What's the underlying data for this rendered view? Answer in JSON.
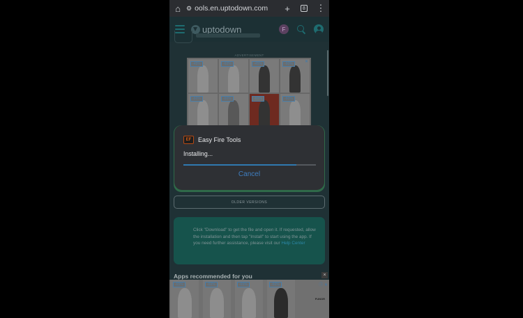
{
  "browser": {
    "url": "ools.en.uptodown.com",
    "tab_count": "8"
  },
  "site": {
    "logo_text": "uptodown",
    "ext_badge": "F"
  },
  "ad_top": {
    "label": "ADVERTISEMENT",
    "discounts": [
      "-45%",
      "-60%",
      "-45%",
      "-60%",
      "-60%",
      "-60%",
      "-60%",
      "-60%"
    ]
  },
  "dialog": {
    "app_name": "Easy Fire Tools",
    "status": "Installing...",
    "progress": 0.85,
    "cancel_label": "Cancel"
  },
  "older_versions_label": "OLDER VERSIONS",
  "info": {
    "text": "Click \"Download\" to get the file and open it. If requested, allow the installation and then tap \"Install\" to start using the app. If you need further assistance, please visit our ",
    "link": "Help Center"
  },
  "recommended": {
    "title": "Apps recommended for you",
    "close": "×"
  },
  "ad_bottom": {
    "discounts": [
      "-65%",
      "-60%",
      "-65%",
      "-60%"
    ],
    "brand": "FUNOR"
  },
  "colors": {
    "accent": "#2f79b0",
    "brand_teal": "#1e6c70",
    "dialog_bg": "#2e3034"
  }
}
